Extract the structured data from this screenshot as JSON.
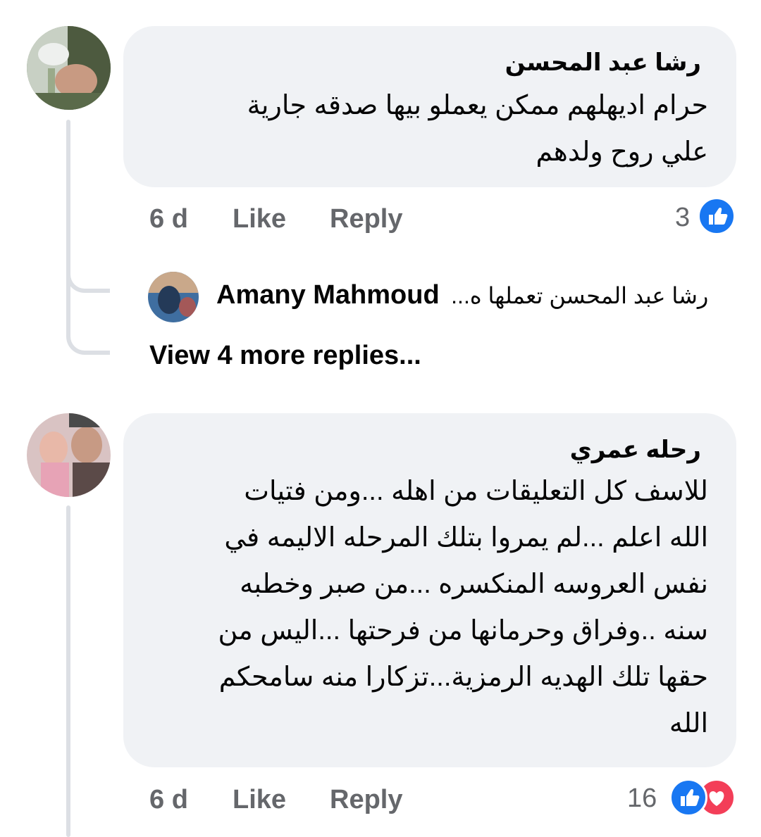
{
  "comments": [
    {
      "author": "رشا عبد المحسن",
      "lines": [
        "حرام اديهلهم ممكن يعملو بيها صدقه جارية",
        "علي روح ولدهم"
      ],
      "time": "6 d",
      "like_label": "Like",
      "reply_label": "Reply",
      "reaction_count": "3",
      "reactions": [
        "like-icon"
      ],
      "reply_preview": {
        "author": "Amany Mahmoud",
        "text": "رشا عبد المحسن تعملها ه..."
      },
      "view_more_label": "View 4 more replies..."
    },
    {
      "author": "رحله عمري",
      "lines": [
        "للاسف كل التعليقات من  اهله ...ومن فتيات",
        "الله اعلم ...لم يمروا بتلك المرحله الاليمه في",
        "نفس العروسه المنكسره ...من صبر وخطبه",
        "سنه ..وفراق وحرمانها من فرحتها ...اليس من",
        "حقها تلك الهديه الرمزية...تزكارا منه سامحكم",
        "الله"
      ],
      "time": "6 d",
      "like_label": "Like",
      "reply_label": "Reply",
      "reaction_count": "16",
      "reactions": [
        "like-icon",
        "love-icon"
      ]
    }
  ],
  "colors": {
    "bubble": "#f0f2f5",
    "meta_text": "#65676b",
    "like_blue": "#1877f2",
    "love_red": "#f33e58",
    "thread_line": "#dcdfe4"
  }
}
